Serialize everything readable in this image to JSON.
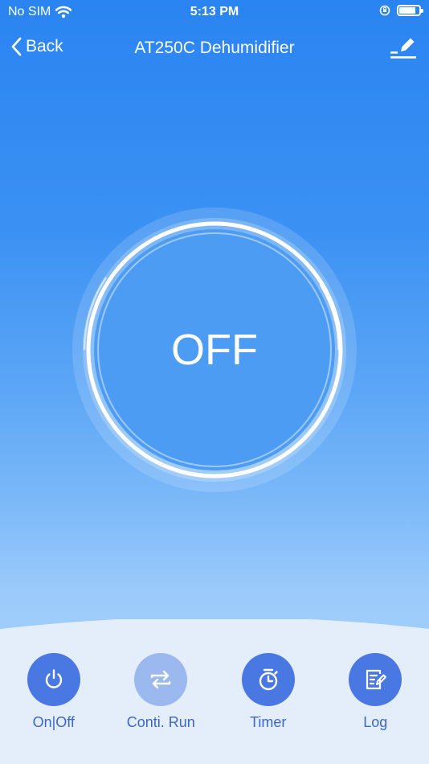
{
  "status_bar": {
    "carrier": "No SIM",
    "time": "5:13 PM",
    "battery_level": 0.85
  },
  "nav": {
    "back_label": "Back",
    "title": "AT250C Dehumidifier"
  },
  "dial": {
    "state_label": "OFF"
  },
  "colors": {
    "button_active": "#4a78e2",
    "button_disabled": "#9bb8ef",
    "label": "#3b67c9"
  },
  "controls": [
    {
      "label": "On|Off",
      "icon": "power-icon",
      "enabled": true
    },
    {
      "label": "Conti. Run",
      "icon": "continuous-run-icon",
      "enabled": false
    },
    {
      "label": "Timer",
      "icon": "timer-icon",
      "enabled": true
    },
    {
      "label": "Log",
      "icon": "log-icon",
      "enabled": true
    }
  ]
}
